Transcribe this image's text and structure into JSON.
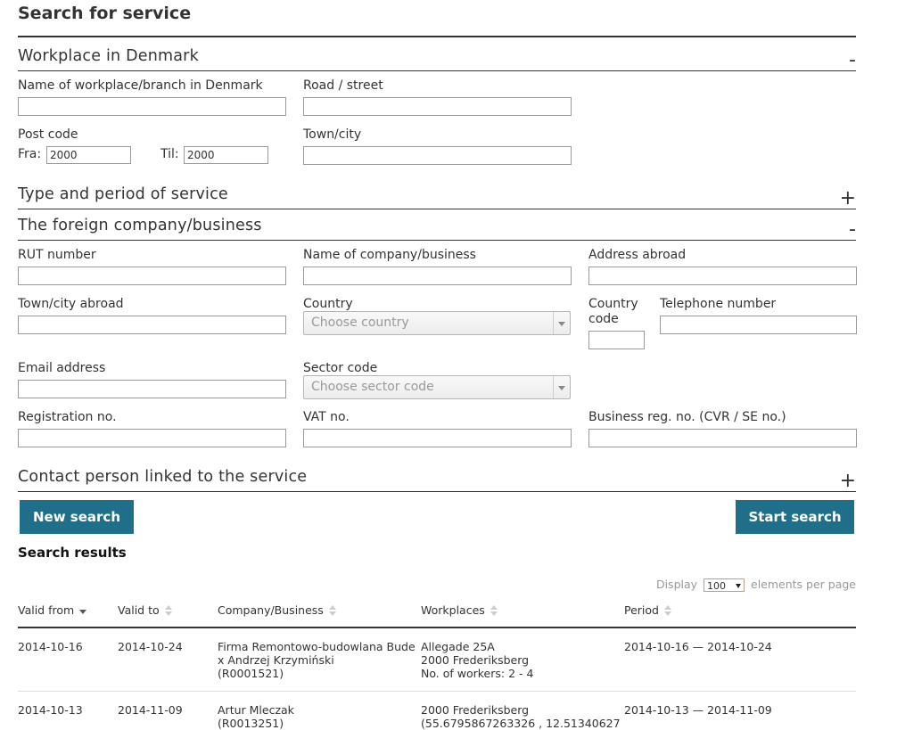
{
  "page_title": "Search for service",
  "sections": {
    "workplace": {
      "title": "Workplace in Denmark",
      "toggle": "-"
    },
    "type_period": {
      "title": "Type and period of service",
      "toggle": "+"
    },
    "foreign_company": {
      "title": "The foreign company/business",
      "toggle": "-"
    },
    "contact_person": {
      "title": "Contact person linked to the service",
      "toggle": "+"
    }
  },
  "workplace": {
    "name_label": "Name of workplace/branch in Denmark",
    "road_label": "Road / street",
    "postcode_label": "Post code",
    "fra_label": "Fra:",
    "fra_value": "2000",
    "til_label": "Til:",
    "til_value": "2000",
    "town_label": "Town/city"
  },
  "company": {
    "rut_label": "RUT number",
    "name_label": "Name of company/business",
    "address_label": "Address abroad",
    "town_label": "Town/city abroad",
    "country_label": "Country",
    "country_placeholder": "Choose country",
    "country_code_label_1": "Country",
    "country_code_label_2": "code",
    "telephone_label": "Telephone number",
    "email_label": "Email address",
    "sector_label": "Sector code",
    "sector_placeholder": "Choose sector code",
    "registration_label": "Registration no.",
    "vat_label": "VAT no.",
    "cvr_label": "Business reg. no. (CVR / SE no.)"
  },
  "buttons": {
    "new_search": "New search",
    "start_search": "Start search"
  },
  "results": {
    "title": "Search results",
    "display_label": "Display",
    "per_page_value": "100",
    "per_page_suffix": "elements per page",
    "columns": [
      "Valid from",
      "Valid to",
      "Company/Business",
      "Workplaces",
      "Period"
    ],
    "rows": [
      {
        "valid_from": "2014-10-16",
        "valid_to": "2014-10-24",
        "company_1": "Firma Remontowo-budowlana Bude",
        "company_2": "x Andrzej Krzymiński",
        "company_3": "(R0001521)",
        "workplace_1": "Allegade 25A",
        "workplace_2": "2000 Frederiksberg",
        "workplace_3": "No. of workers: 2 - 4",
        "period": "2014-10-16 — 2014-10-24"
      },
      {
        "valid_from": "2014-10-13",
        "valid_to": "2014-11-09",
        "company_1": "Artur Mleczak",
        "company_2": "(R0013251)",
        "workplace_1": "2000 Frederiksberg",
        "workplace_2": "(55.6795867263326 , 12.51340627",
        "period": "2014-10-13 — 2014-11-09"
      }
    ]
  },
  "colors": {
    "button": "#1f6f8b",
    "rule": "#333333"
  }
}
